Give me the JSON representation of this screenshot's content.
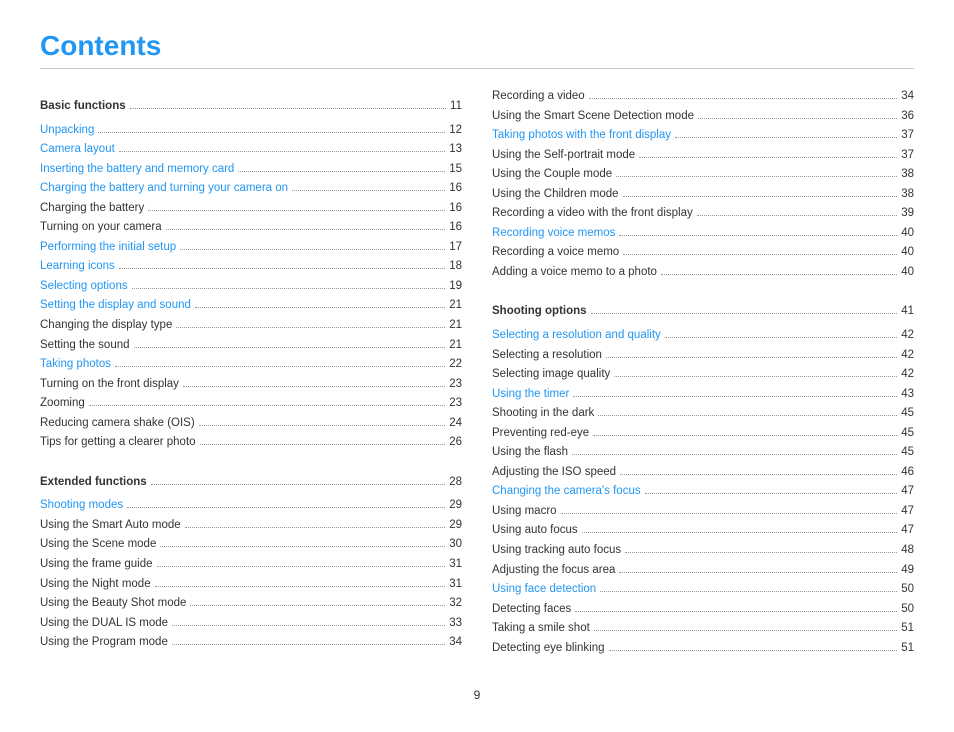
{
  "title": "Contents",
  "footer_page": "9",
  "left_column": {
    "sections": [
      {
        "title": "Basic functions",
        "title_page": "11",
        "entries": [
          {
            "label": "Unpacking",
            "page": "12",
            "blue": true
          },
          {
            "label": "Camera layout",
            "page": "13",
            "blue": true
          },
          {
            "label": "Inserting the battery and memory card",
            "page": "15",
            "blue": true
          },
          {
            "label": "Charging the battery and turning your camera on",
            "page": "16",
            "blue": true
          },
          {
            "label": "Charging the battery",
            "page": "16",
            "blue": false
          },
          {
            "label": "Turning on your camera",
            "page": "16",
            "blue": false
          },
          {
            "label": "Performing the initial setup",
            "page": "17",
            "blue": true
          },
          {
            "label": "Learning icons",
            "page": "18",
            "blue": true
          },
          {
            "label": "Selecting options",
            "page": "19",
            "blue": true
          },
          {
            "label": "Setting the display and sound",
            "page": "21",
            "blue": true
          },
          {
            "label": "Changing the display type",
            "page": "21",
            "blue": false
          },
          {
            "label": "Setting the sound",
            "page": "21",
            "blue": false
          },
          {
            "label": "Taking photos",
            "page": "22",
            "blue": true
          },
          {
            "label": "Turning on the front display",
            "page": "23",
            "blue": false
          },
          {
            "label": "Zooming",
            "page": "23",
            "blue": false
          },
          {
            "label": "Reducing camera shake (OIS)",
            "page": "24",
            "blue": false
          },
          {
            "label": "Tips for getting a clearer photo",
            "page": "26",
            "blue": false
          }
        ]
      },
      {
        "title": "Extended functions",
        "title_page": "28",
        "entries": [
          {
            "label": "Shooting modes",
            "page": "29",
            "blue": true
          },
          {
            "label": "Using the Smart Auto mode",
            "page": "29",
            "blue": false
          },
          {
            "label": "Using the Scene mode",
            "page": "30",
            "blue": false
          },
          {
            "label": "Using the frame guide",
            "page": "31",
            "blue": false
          },
          {
            "label": "Using the Night mode",
            "page": "31",
            "blue": false
          },
          {
            "label": "Using the Beauty Shot mode",
            "page": "32",
            "blue": false
          },
          {
            "label": "Using the DUAL IS mode",
            "page": "33",
            "blue": false
          },
          {
            "label": "Using the Program mode",
            "page": "34",
            "blue": false
          }
        ]
      }
    ]
  },
  "right_column": {
    "sections": [
      {
        "title": "",
        "title_page": "",
        "entries": [
          {
            "label": "Recording a video",
            "page": "34",
            "blue": false
          },
          {
            "label": "Using the Smart Scene Detection mode",
            "page": "36",
            "blue": false
          },
          {
            "label": "Taking photos with the front display",
            "page": "37",
            "blue": true
          },
          {
            "label": "Using the Self-portrait mode",
            "page": "37",
            "blue": false
          },
          {
            "label": "Using the Couple mode",
            "page": "38",
            "blue": false
          },
          {
            "label": "Using the Children mode",
            "page": "38",
            "blue": false
          },
          {
            "label": "Recording a video with the front display",
            "page": "39",
            "blue": false
          },
          {
            "label": "Recording voice memos",
            "page": "40",
            "blue": true
          },
          {
            "label": "Recording a voice memo",
            "page": "40",
            "blue": false
          },
          {
            "label": "Adding a voice memo to a photo",
            "page": "40",
            "blue": false
          }
        ]
      },
      {
        "title": "Shooting options",
        "title_page": "41",
        "entries": [
          {
            "label": "Selecting a resolution and quality",
            "page": "42",
            "blue": true
          },
          {
            "label": "Selecting a resolution",
            "page": "42",
            "blue": false
          },
          {
            "label": "Selecting image quality",
            "page": "42",
            "blue": false
          },
          {
            "label": "Using the timer",
            "page": "43",
            "blue": true
          },
          {
            "label": "Shooting in the dark",
            "page": "45",
            "blue": false
          },
          {
            "label": "Preventing red-eye",
            "page": "45",
            "blue": false
          },
          {
            "label": "Using the flash",
            "page": "45",
            "blue": false
          },
          {
            "label": "Adjusting the ISO speed",
            "page": "46",
            "blue": false
          },
          {
            "label": "Changing the camera's focus",
            "page": "47",
            "blue": true
          },
          {
            "label": "Using macro",
            "page": "47",
            "blue": false
          },
          {
            "label": "Using auto focus",
            "page": "47",
            "blue": false
          },
          {
            "label": "Using tracking auto focus",
            "page": "48",
            "blue": false
          },
          {
            "label": "Adjusting the focus area",
            "page": "49",
            "blue": false
          },
          {
            "label": "Using face detection",
            "page": "50",
            "blue": true
          },
          {
            "label": "Detecting faces",
            "page": "50",
            "blue": false
          },
          {
            "label": "Taking a smile shot",
            "page": "51",
            "blue": false
          },
          {
            "label": "Detecting eye blinking",
            "page": "51",
            "blue": false
          }
        ]
      }
    ]
  }
}
